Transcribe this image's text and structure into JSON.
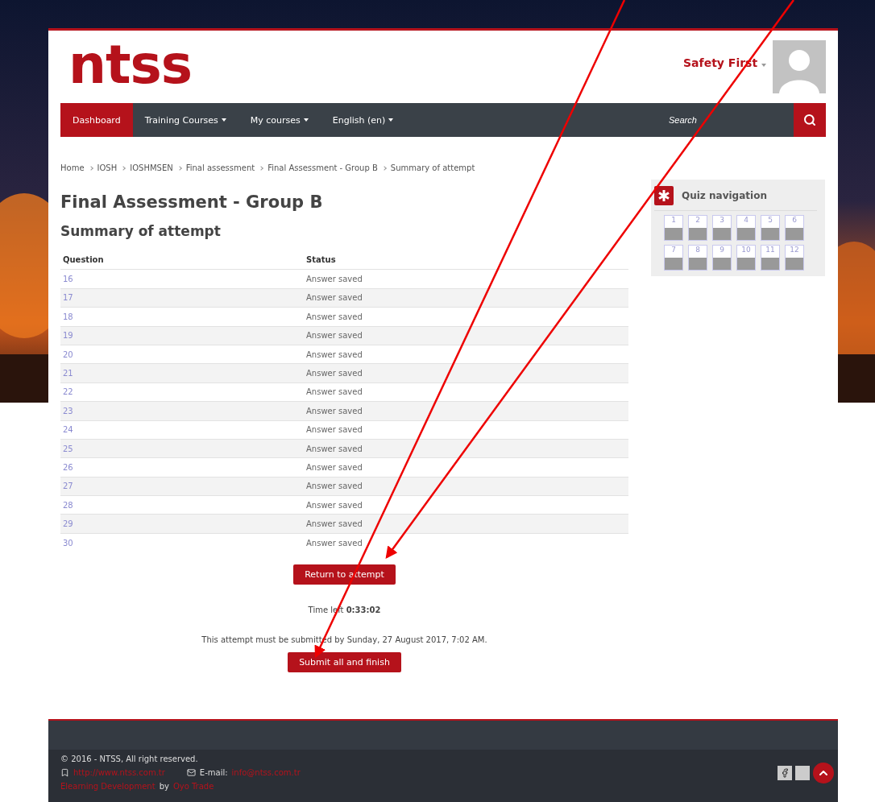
{
  "header": {
    "logo": "ntss",
    "user_name": "Safety First"
  },
  "nav": {
    "items": [
      {
        "label": "Dashboard",
        "selected": true,
        "has_menu": false
      },
      {
        "label": "Training Courses",
        "selected": false,
        "has_menu": true
      },
      {
        "label": "My courses",
        "selected": false,
        "has_menu": true
      },
      {
        "label": "English (en)",
        "selected": false,
        "has_menu": true
      }
    ],
    "search": {
      "placeholder": "Search"
    }
  },
  "breadcrumb": [
    "Home",
    "IOSH",
    "IOSHMSEN",
    "Final assessment",
    "Final Assessment - Group B",
    "Summary of attempt"
  ],
  "title": "Final Assessment - Group B",
  "subtitle": "Summary of attempt",
  "table": {
    "columns": [
      "Question",
      "Status"
    ],
    "rows": [
      {
        "question": "16",
        "status": "Answer saved"
      },
      {
        "question": "17",
        "status": "Answer saved"
      },
      {
        "question": "18",
        "status": "Answer saved"
      },
      {
        "question": "19",
        "status": "Answer saved"
      },
      {
        "question": "20",
        "status": "Answer saved"
      },
      {
        "question": "21",
        "status": "Answer saved"
      },
      {
        "question": "22",
        "status": "Answer saved"
      },
      {
        "question": "23",
        "status": "Answer saved"
      },
      {
        "question": "24",
        "status": "Answer saved"
      },
      {
        "question": "25",
        "status": "Answer saved"
      },
      {
        "question": "26",
        "status": "Answer saved"
      },
      {
        "question": "27",
        "status": "Answer saved"
      },
      {
        "question": "28",
        "status": "Answer saved"
      },
      {
        "question": "29",
        "status": "Answer saved"
      },
      {
        "question": "30",
        "status": "Answer saved"
      }
    ]
  },
  "return_button": "Return to attempt",
  "time_left": {
    "label": "Time left",
    "value": "0:33:02"
  },
  "deadline": "This attempt must be submitted by Sunday, 27 August 2017, 7:02 AM.",
  "submit_button": "Submit all and finish",
  "quiz_navigation": {
    "title": "Quiz navigation",
    "buttons": [
      {
        "label": "1",
        "answered": true
      },
      {
        "label": "2",
        "answered": true
      },
      {
        "label": "3",
        "answered": true
      },
      {
        "label": "4",
        "answered": true
      },
      {
        "label": "5",
        "answered": true
      },
      {
        "label": "6",
        "answered": true
      },
      {
        "label": "7",
        "answered": true
      },
      {
        "label": "8",
        "answered": true
      },
      {
        "label": "9",
        "answered": true
      },
      {
        "label": "10",
        "answered": true
      },
      {
        "label": "11",
        "answered": true
      },
      {
        "label": "12",
        "answered": true
      }
    ]
  },
  "footer": {
    "copyright": "© 2016 - NTSS, All right reserved.",
    "website": "http://www.ntss.com.tr",
    "email_label": "E-mail:",
    "email": "info@ntss.com.tr",
    "credit_link": "Elearning Development",
    "credit_by": "by",
    "credit_company": "Oyo Trade"
  }
}
